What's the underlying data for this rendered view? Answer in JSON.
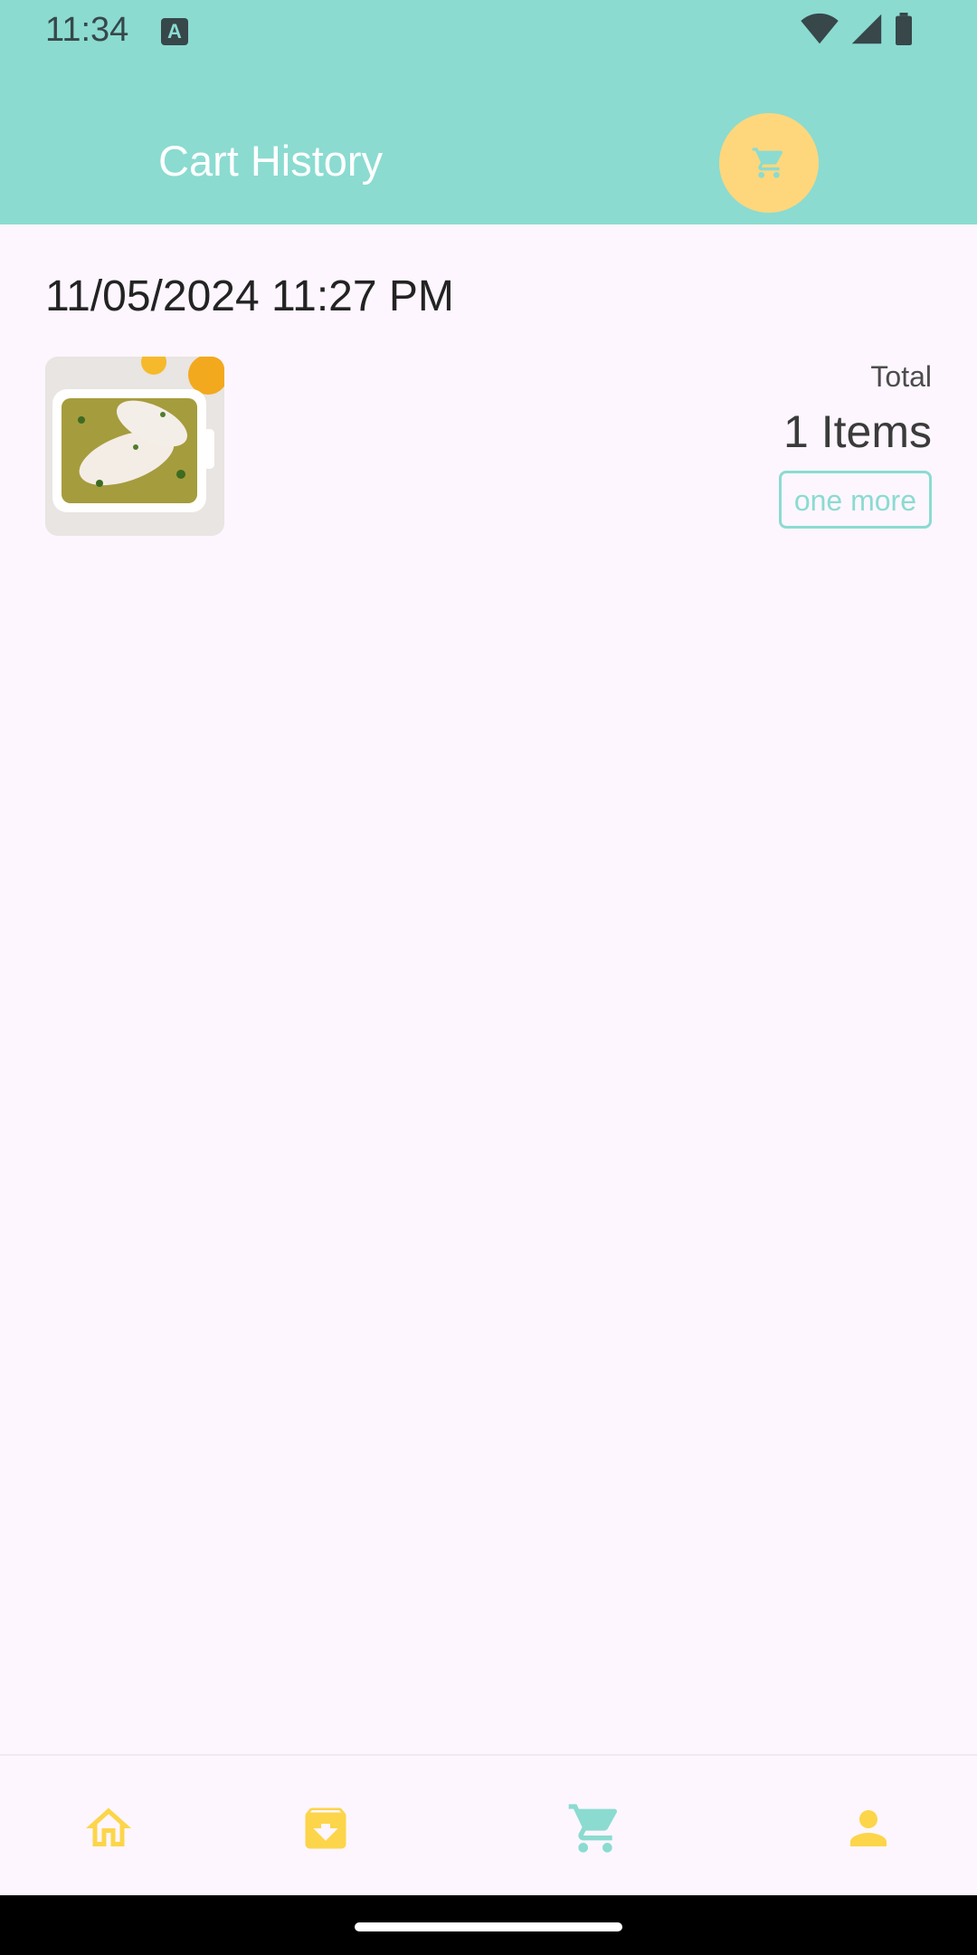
{
  "status_bar": {
    "time": "11:34",
    "app_icon_letter": "A",
    "icons": [
      "wifi-icon",
      "cellular-signal-icon",
      "battery-icon"
    ]
  },
  "app_bar": {
    "title": "Cart History",
    "action_icon": "cart-icon"
  },
  "history": [
    {
      "date": "11/05/2024 11:27 PM",
      "total_label": "Total",
      "items_label": "1 Items",
      "button_label": "one more",
      "thumbnail": "chicken-dish-image"
    }
  ],
  "bottom_nav": {
    "items": [
      {
        "icon": "home-icon",
        "color": "#fcd54a"
      },
      {
        "icon": "archive-icon",
        "color": "#fcd54a"
      },
      {
        "icon": "cart-icon",
        "color": "#8bdbd1"
      },
      {
        "icon": "person-icon",
        "color": "#fcd54a"
      }
    ]
  },
  "colors": {
    "primary": "#8bdbd1",
    "accent": "#fed77c",
    "nav_inactive": "#fcd54a",
    "background": "#fdf6fe"
  }
}
